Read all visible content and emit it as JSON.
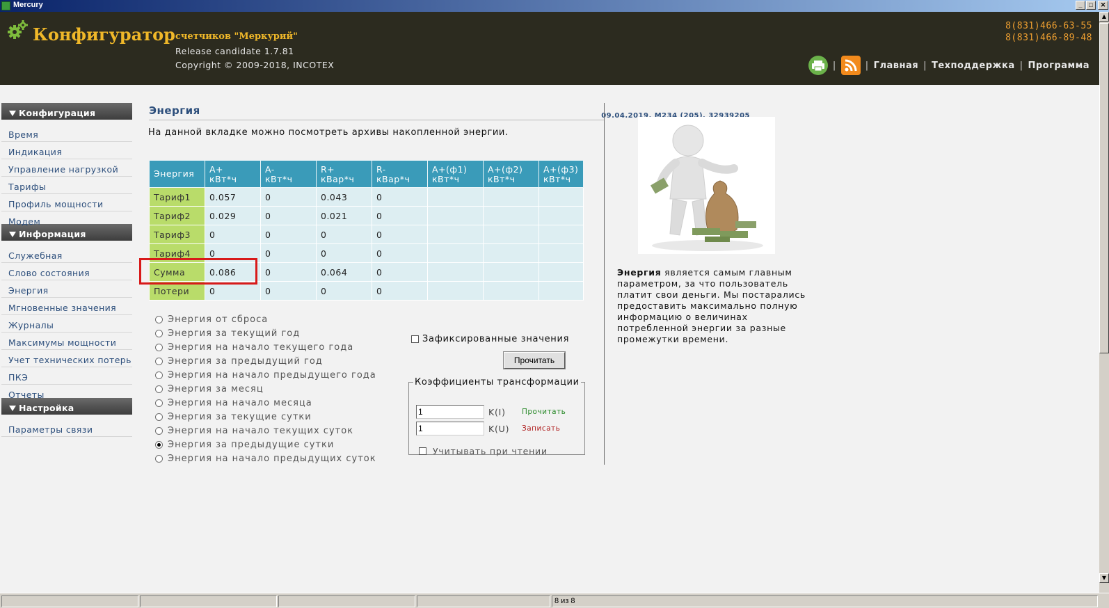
{
  "window": {
    "title": "Mercury",
    "minimize": "_",
    "maximize": "□",
    "close": "✕"
  },
  "header": {
    "brand": "Конфигуратор",
    "subtitle": "счетчиков \"Меркурий\"",
    "release": "Release candidate 1.7.81",
    "copyright": "Copyright © 2009-2018, INCOTEX",
    "phone1": "8(831)466-63-55",
    "phone2": "8(831)466-89-48",
    "nav": {
      "home": "Главная",
      "support": "Техподдержка",
      "program": "Программа"
    },
    "icons": {
      "logo": "gear-icon",
      "print": "printer-icon",
      "rss": "rss-icon"
    }
  },
  "sidebar": {
    "sections": [
      {
        "title": "Конфигурация",
        "items": [
          "Время",
          "Индикация",
          "Управление нагрузкой",
          "Тарифы",
          "Профиль мощности",
          "Модем"
        ]
      },
      {
        "title": "Информация",
        "items": [
          "Служебная",
          "Слово состояния",
          "Энергия",
          "Мгновенные значения",
          "Журналы",
          "Максимумы мощности",
          "Учет технических потерь",
          "ПКЭ",
          "Отчеты"
        ]
      },
      {
        "title": "Настройка",
        "items": [
          "Параметры связи"
        ]
      }
    ]
  },
  "main": {
    "title": "Энергия",
    "meta": "09.04.2019, M234 (205), 32939205",
    "description": "На данной вкладке можно посмотреть архивы накопленной энергии.",
    "table": {
      "headers": [
        [
          "Энергия",
          ""
        ],
        [
          "A+",
          "кВт*ч"
        ],
        [
          "A-",
          "кВт*ч"
        ],
        [
          "R+",
          "кВар*ч"
        ],
        [
          "R-",
          "кВар*ч"
        ],
        [
          "A+(ф1)",
          "кВт*ч"
        ],
        [
          "A+(ф2)",
          "кВт*ч"
        ],
        [
          "A+(ф3)",
          "кВт*ч"
        ]
      ],
      "rows": [
        [
          "Тариф1",
          "0.057",
          "0",
          "0.043",
          "0",
          "",
          "",
          ""
        ],
        [
          "Тариф2",
          "0.029",
          "0",
          "0.021",
          "0",
          "",
          "",
          ""
        ],
        [
          "Тариф3",
          "0",
          "0",
          "0",
          "0",
          "",
          "",
          ""
        ],
        [
          "Тариф4",
          "0",
          "0",
          "0",
          "0",
          "",
          "",
          ""
        ],
        [
          "Сумма",
          "0.086",
          "0",
          "0.064",
          "0",
          "",
          "",
          ""
        ],
        [
          "Потери",
          "0",
          "0",
          "0",
          "0",
          "",
          "",
          ""
        ]
      ]
    },
    "radios": [
      "Энергия от сброса",
      "Энергия за текущий год",
      "Энергия на начало текущего года",
      "Энергия за предыдущий год",
      "Энергия на начало предыдущего года",
      "Энергия за месяц",
      "Энергия на начало месяца",
      "Энергия за текущие сутки",
      "Энергия на начало текущих суток",
      "Энергия за предыдущие сутки",
      "Энергия на начало предыдущих суток"
    ],
    "selected_radio": 9,
    "fixed_values_label": "Зафиксированные значения",
    "read_button": "Прочитать",
    "coeff": {
      "legend": "Коэффициенты трансформации",
      "ki_value": "1",
      "ki_label": "K(I)",
      "ku_value": "1",
      "ku_label": "K(U)",
      "read": "Прочитать",
      "write": "Записать",
      "apply_label": "Учитывать при чтении"
    }
  },
  "info": {
    "bold": "Энергия",
    "text": " является самым главным параметром, за что пользователь платит свои деньги. Мы постарались предоставить максимально полную информацию о величинах потребленной энергии за разные промежутки времени."
  },
  "statusbar": {
    "page": "8 из 8"
  },
  "colors": {
    "header_bg": "#2c2b1f",
    "brand": "#f0b829",
    "table_head": "#3a9bb9",
    "row_label": "#b9dc6a",
    "cell": "#ddeef2",
    "highlight": "#d81a1a"
  }
}
